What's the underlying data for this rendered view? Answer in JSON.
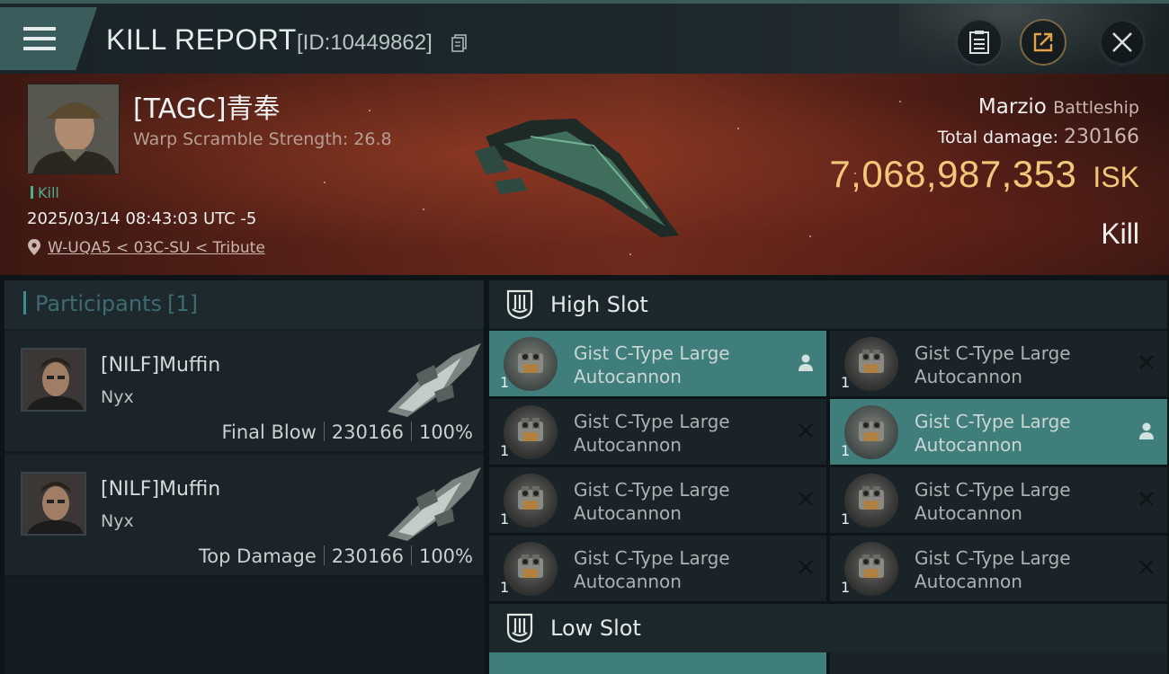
{
  "header": {
    "title": "KILL REPORT",
    "id_label": "[ID:10449862]",
    "icons": [
      "menu-icon",
      "copy-icon",
      "document-icon",
      "share-icon",
      "close-icon"
    ]
  },
  "victim": {
    "name": "[TAGC]青奉",
    "scramble": "Warp Scramble Strength: 26.8",
    "kill_tag": "Kill",
    "datetime": "2025/03/14 08:43:03 UTC -5",
    "location": "W-UQA5 < 03C-SU < Tribute"
  },
  "ship": {
    "name": "Marzio",
    "class": "Battleship",
    "total_damage_label": "Total damage:",
    "total_damage": "230166",
    "isk_value": "7,068,987,353",
    "isk_unit": "ISK",
    "result": "Kill"
  },
  "participants": {
    "title": "Participants",
    "count": "[1]",
    "rows": [
      {
        "name": "[NILF]Muffin",
        "ship": "Nyx",
        "role": "Final Blow",
        "damage": "230166",
        "percent": "100%"
      },
      {
        "name": "[NILF]Muffin",
        "ship": "Nyx",
        "role": "Top Damage",
        "damage": "230166",
        "percent": "100%"
      }
    ]
  },
  "slots": {
    "high": {
      "title": "High Slot",
      "modules": [
        {
          "line1": "Gist C-Type Large",
          "line2": "Autocannon",
          "qty": "1",
          "state": "dropped"
        },
        {
          "line1": "Gist C-Type Large",
          "line2": "Autocannon",
          "qty": "1",
          "state": "destroyed"
        },
        {
          "line1": "Gist C-Type Large",
          "line2": "Autocannon",
          "qty": "1",
          "state": "destroyed"
        },
        {
          "line1": "Gist C-Type Large",
          "line2": "Autocannon",
          "qty": "1",
          "state": "dropped"
        },
        {
          "line1": "Gist C-Type Large",
          "line2": "Autocannon",
          "qty": "1",
          "state": "destroyed"
        },
        {
          "line1": "Gist C-Type Large",
          "line2": "Autocannon",
          "qty": "1",
          "state": "destroyed"
        },
        {
          "line1": "Gist C-Type Large",
          "line2": "Autocannon",
          "qty": "1",
          "state": "destroyed"
        },
        {
          "line1": "Gist C-Type Large",
          "line2": "Autocannon",
          "qty": "1",
          "state": "destroyed"
        }
      ]
    },
    "low": {
      "title": "Low Slot"
    }
  },
  "colors": {
    "accent_teal": "#3f7e7a",
    "isk_gold": "#f2c77a",
    "kill_green": "#4fae8e"
  }
}
